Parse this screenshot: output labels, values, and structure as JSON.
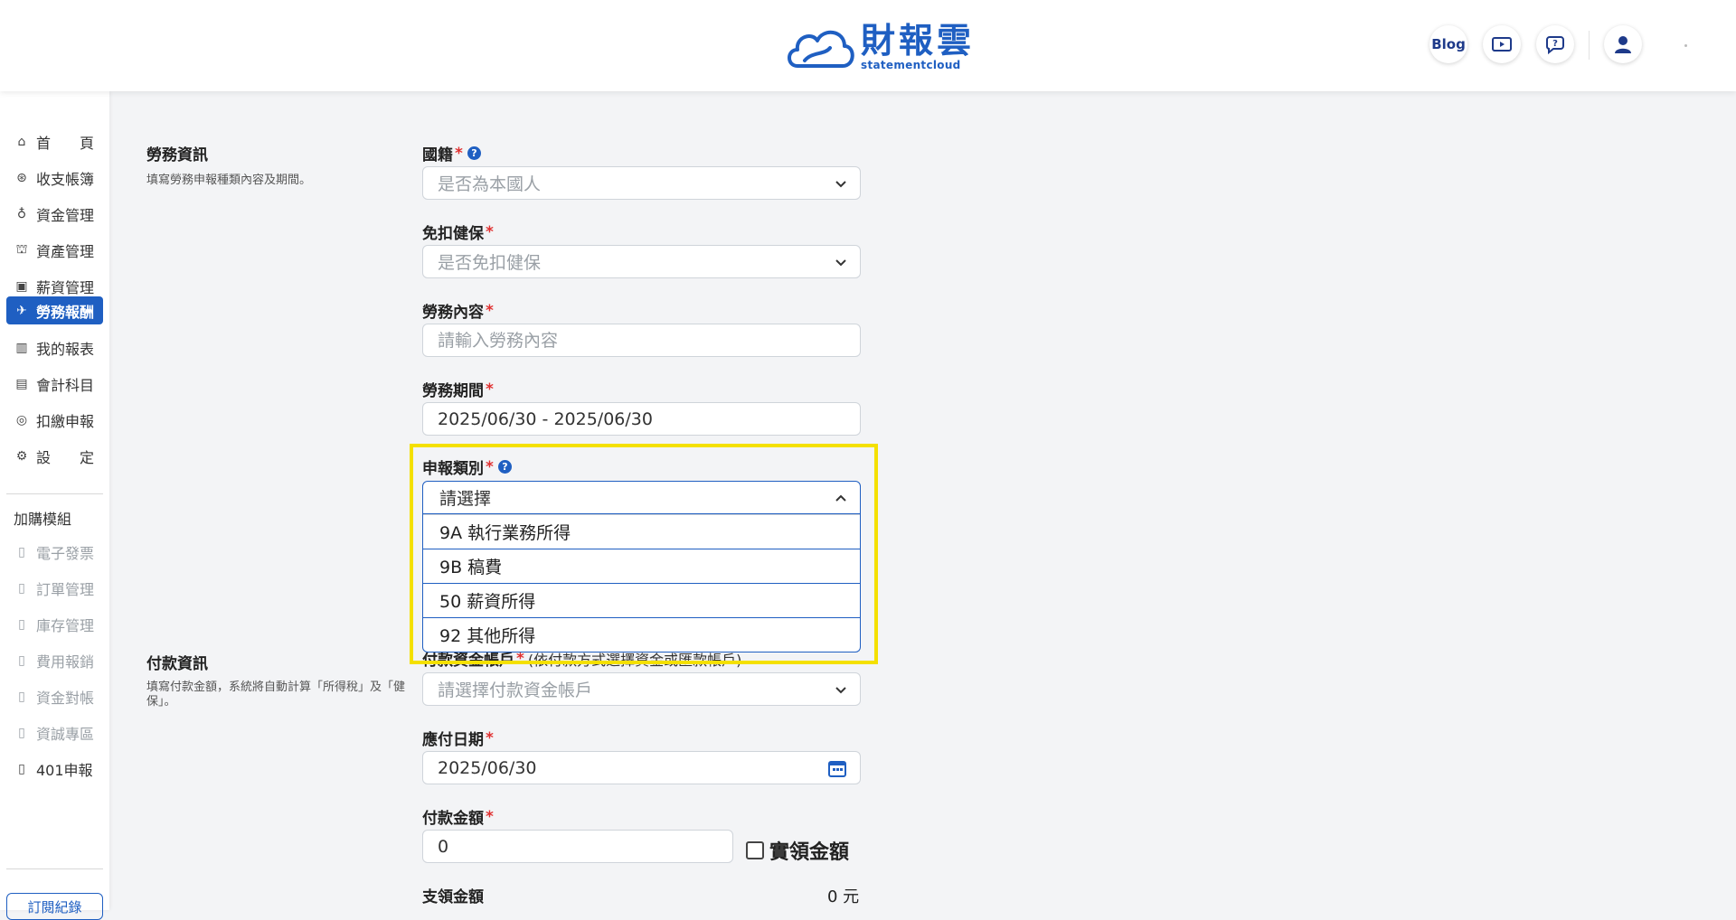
{
  "header": {
    "logo_cn": "財報雲",
    "logo_en": "statementcloud",
    "blog_label": "Blog"
  },
  "sidebar": {
    "items": [
      {
        "label": "首頁",
        "icon": "home-icon"
      },
      {
        "label": "收支帳簿",
        "icon": "coin-icon"
      },
      {
        "label": "資金管理",
        "icon": "money-bag-icon"
      },
      {
        "label": "資產管理",
        "icon": "bank-icon"
      },
      {
        "label": "薪資管理",
        "icon": "payroll-icon"
      },
      {
        "label": "勞務報酬",
        "icon": "labor-icon"
      },
      {
        "label": "我的報表",
        "icon": "bar-chart-icon"
      },
      {
        "label": "會計科目",
        "icon": "ledger-icon"
      },
      {
        "label": "扣繳申報",
        "icon": "tax-icon"
      },
      {
        "label": "設定",
        "icon": "settings-icon"
      }
    ],
    "addon_heading": "加購模組",
    "addons": [
      {
        "label": "電子發票"
      },
      {
        "label": "訂單管理"
      },
      {
        "label": "庫存管理"
      },
      {
        "label": "費用報銷"
      },
      {
        "label": "資金對帳"
      },
      {
        "label": "資誠專區"
      },
      {
        "label": "401申報"
      }
    ],
    "subscription_label": "訂閱紀錄"
  },
  "labor_section": {
    "title": "勞務資訊",
    "desc": "填寫勞務申報種類內容及期間。",
    "nationality": {
      "label": "國籍",
      "placeholder": "是否為本國人"
    },
    "health_exempt": {
      "label": "免扣健保",
      "placeholder": "是否免扣健保"
    },
    "content": {
      "label": "勞務內容",
      "placeholder": "請輸入勞務內容"
    },
    "period": {
      "label": "勞務期間",
      "value": "2025/06/30 - 2025/06/30"
    },
    "category": {
      "label": "申報類別",
      "placeholder": "請選擇",
      "options": [
        "9A 執行業務所得",
        "9B 稿費",
        "50 薪資所得",
        "92 其他所得"
      ]
    }
  },
  "payment_section": {
    "title": "付款資訊",
    "desc": "填寫付款金額，系統將自動計算「所得稅」及「健保」。",
    "account": {
      "label": "付款資金帳戶",
      "note": "(依付款方式選擇資金或匯款帳戶)",
      "placeholder": "請選擇付款資金帳戶"
    },
    "due_date": {
      "label": "應付日期",
      "value": "2025/06/30"
    },
    "amount": {
      "label": "付款金額",
      "value": "0",
      "net_checkbox_label": "實領金額"
    },
    "paid_amount": {
      "label": "支領金額",
      "value": "0 元"
    }
  },
  "colors": {
    "primary": "#1f5fc2",
    "highlight": "#f4e000",
    "required": "#e03131"
  }
}
